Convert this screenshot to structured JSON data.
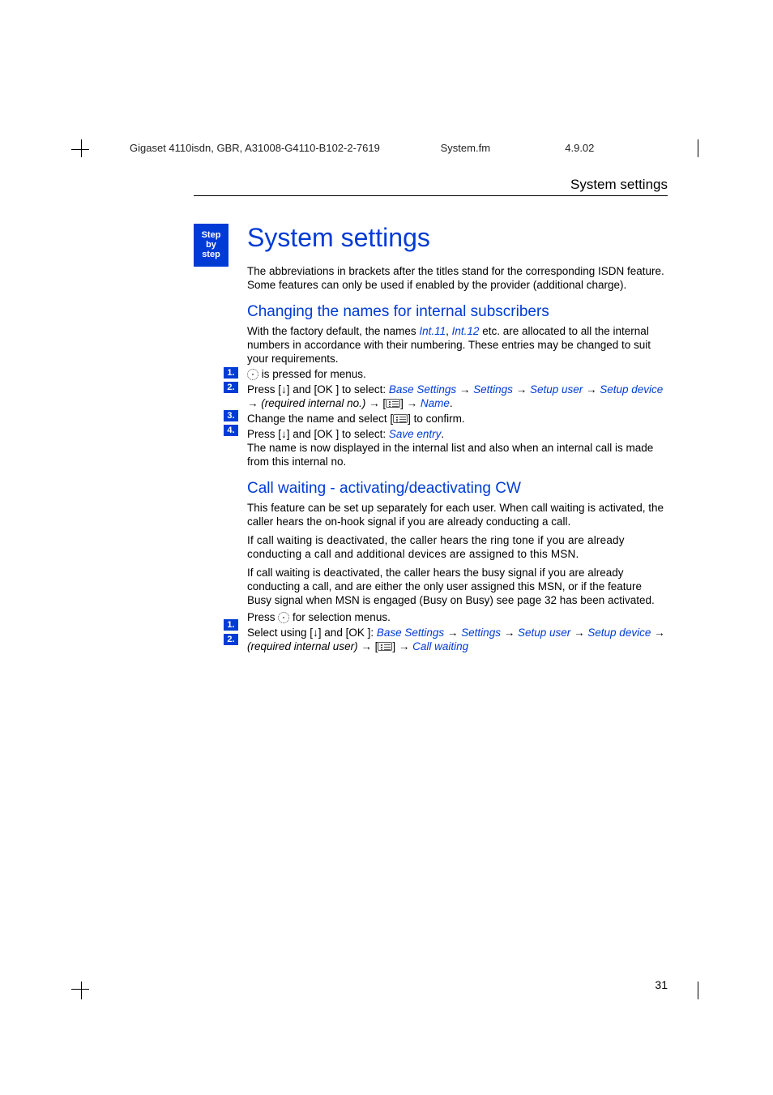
{
  "header": {
    "doc": "Gigaset 4110isdn, GBR, A31008-G4110-B102-2-7619",
    "file": "System.fm",
    "date": "4.9.02"
  },
  "running_head": "System settings",
  "side_tab": {
    "l1": "Step",
    "l2": "by",
    "l3": "step"
  },
  "title": "System settings",
  "intro": "The abbreviations in brackets after the titles stand for the corresponding ISDN feature. Some features can only be used if enabled by the provider (additional charge).",
  "sectA": {
    "heading": "Changing the names for internal subscribers",
    "lead_a": "With the factory default, the names ",
    "int11": "Int.11",
    "comma": ", ",
    "int12": "Int.12",
    "lead_b": " etc. are allocated to all the internal numbers in accordance with their numbering. These entries may be changed to suit your requirements.",
    "steps": {
      "s1": " is pressed for menus.",
      "s2_a": "Press [",
      "down": "↓",
      "s2_b": "] and [OK ] to select: ",
      "path1": "Base Settings",
      "arrow": " → ",
      "path2": "Settings",
      "path3": "Setup user",
      "path4": "Setup device",
      "req_no": " (required internal no.) ",
      "name": "Name",
      "period": ".",
      "s3_a": "Change the name and select ",
      "s3_b": " to confirm.",
      "s4_a": "Press [",
      "s4_b": "] and [OK ] to select: ",
      "save": "Save entry",
      "s4_tail": "The name is now displayed in the internal list and also when an internal call is made from this internal no."
    }
  },
  "sectB": {
    "heading": "Call waiting - activating/deactivating CW",
    "p1": "This feature can be set up separately for each user. When call waiting is activated, the caller hears the on-hook signal if you are already conducting a call.",
    "p2": "If call waiting is deactivated, the caller hears the ring tone if you are already conducting a call and additional devices are assigned to this MSN.",
    "p3": "If call waiting is deactivated, the caller hears the busy signal if you are already conducting a call, and are either the only user assigned this MSN, or if the feature Busy signal when MSN is engaged (Busy on Busy) see page 32 has been activated.",
    "steps": {
      "s1_a": "Press ",
      "s1_b": " for selection menus.",
      "s2_a": "Select using [",
      "s2_b": "] and [OK ]: ",
      "path1": "Base Settings",
      "path2": "Settings",
      "path3": "Setup user",
      "path4": "Setup device",
      "req_user": " (required internal user) ",
      "cw": "Call waiting"
    }
  },
  "badges": {
    "n1": "1.",
    "n2": "2.",
    "n3": "3.",
    "n4": "4."
  },
  "pagenum": "31"
}
